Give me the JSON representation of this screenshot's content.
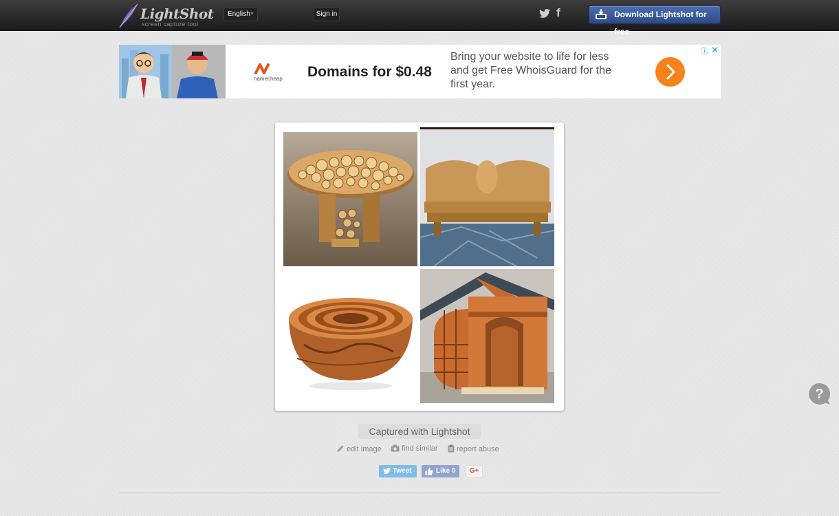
{
  "header": {
    "logo_name": "LightShot",
    "logo_tagline": "screen capture tool",
    "language_label": "English",
    "signin_label": "Sign in",
    "twitter_icon": "twitter-icon",
    "facebook_label": "f",
    "download_label": "Download Lightshot for free"
  },
  "ad": {
    "brand_name": "namecheap",
    "headline": "Domains for $0.48",
    "text": "Bring your website to life for less and get Free WhoisGuard for the first year.",
    "choices_label": "ⓘ",
    "close_label": "✕",
    "accent_color": "#f7821b"
  },
  "screenshot": {
    "tiles": [
      "table",
      "bench",
      "bowls",
      "doghouse"
    ]
  },
  "footer": {
    "caption": "Captured with Lightshot",
    "actions": {
      "edit": "edit image",
      "similar": "find similar",
      "report": "report abuse"
    },
    "share": {
      "tweet": "Tweet",
      "like": "Like 0",
      "gplus": "G+"
    }
  },
  "help_label": "?"
}
